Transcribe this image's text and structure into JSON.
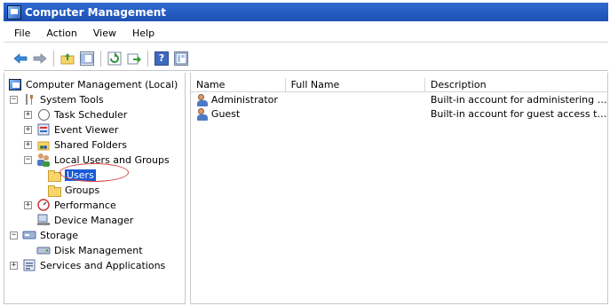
{
  "window": {
    "title": "Computer Management"
  },
  "menu": {
    "items": [
      "File",
      "Action",
      "View",
      "Help"
    ]
  },
  "toolbar": {
    "buttons": [
      "back-icon",
      "forward-icon",
      "up-folder-icon",
      "show-hide-tree-icon",
      "refresh-icon",
      "export-list-icon",
      "help-icon",
      "properties-icon"
    ],
    "help_glyph": "?"
  },
  "tree": {
    "root": "Computer Management (Local)",
    "system_tools": "System Tools",
    "task_scheduler": "Task Scheduler",
    "event_viewer": "Event Viewer",
    "shared_folders": "Shared Folders",
    "local_users_groups": "Local Users and Groups",
    "users": "Users",
    "groups": "Groups",
    "performance": "Performance",
    "device_manager": "Device Manager",
    "storage": "Storage",
    "disk_management": "Disk Management",
    "services_apps": "Services and Applications",
    "expanders": {
      "plus": "+",
      "minus": "−"
    }
  },
  "list": {
    "columns": [
      "Name",
      "Full Name",
      "Description"
    ],
    "rows": [
      {
        "name": "Administrator",
        "full_name": "",
        "description": "Built-in account for administering the..."
      },
      {
        "name": "Guest",
        "full_name": "",
        "description": "Built-in account for guest access to t..."
      }
    ]
  },
  "colors": {
    "title_bar": "#1c4fb5",
    "selection": "#1a5ad7",
    "annotation_oval": "#d64040"
  }
}
